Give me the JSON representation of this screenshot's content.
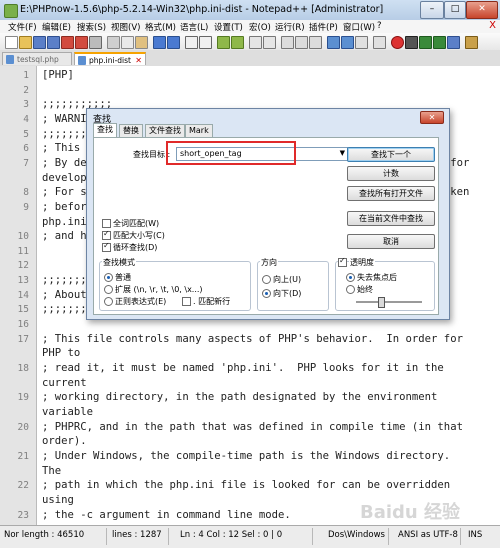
{
  "window": {
    "title": "E:\\PHPnow-1.5.6\\php-5.2.14-Win32\\php.ini-dist - Notepad++ [Administrator]",
    "minimize": "–",
    "maximize": "□",
    "close": "✕"
  },
  "menu": [
    "文件(F)",
    "编辑(E)",
    "搜索(S)",
    "视图(V)",
    "格式(M)",
    "语言(L)",
    "设置(T)",
    "宏(O)",
    "运行(R)",
    "插件(P)",
    "窗口(W)",
    "?"
  ],
  "menu_close": "X",
  "tabs": [
    {
      "label": "testsql.php",
      "active": false
    },
    {
      "label": "php.ini-dist",
      "active": true
    }
  ],
  "editor": {
    "lines": [
      {
        "num": "1",
        "text": "[PHP]"
      },
      {
        "num": "2",
        "text": ""
      },
      {
        "num": "3",
        "text": ";;;;;;;;;;;"
      },
      {
        "num": "4",
        "text": "; WARNING ;"
      },
      {
        "num": "5",
        "text": ";;;;;;;;;;;"
      },
      {
        "num": "6",
        "text": "; This is the default settings file for new PHP installations."
      },
      {
        "num": "7",
        "text": "; By default, PHP installs itself with a configuration suitable for"
      },
      {
        "num": "",
        "text": "development purposes, and *NOT* for production purposes."
      },
      {
        "num": "8",
        "text": "; For several security-oriented considerations that should be taken"
      },
      {
        "num": "9",
        "text": "; before going online with your site, please consult"
      },
      {
        "num": "",
        "text": "php.ini-recommended and http://php.net/manual/en/security.php."
      },
      {
        "num": "10",
        "text": "; and http://php.net/manual/en/security.php."
      },
      {
        "num": "11",
        "text": ""
      },
      {
        "num": "12",
        "text": ""
      },
      {
        "num": "13",
        "text": ";;;;;;;;;;;;;;;;;;;;"
      },
      {
        "num": "14",
        "text": "; About this file ;"
      },
      {
        "num": "15",
        "text": ";;;;;;;;;;;;;;;;;;;;"
      },
      {
        "num": "16",
        "text": ""
      },
      {
        "num": "17",
        "text": "; This file controls many aspects of PHP's behavior.  In order for"
      },
      {
        "num": "",
        "text": "PHP to"
      },
      {
        "num": "18",
        "text": "; read it, it must be named 'php.ini'.  PHP looks for it in the"
      },
      {
        "num": "",
        "text": "current"
      },
      {
        "num": "19",
        "text": "; working directory, in the path designated by the environment"
      },
      {
        "num": "",
        "text": "variable"
      },
      {
        "num": "20",
        "text": "; PHPRC, and in the path that was defined in compile time (in that"
      },
      {
        "num": "",
        "text": "order)."
      },
      {
        "num": "21",
        "text": "; Under Windows, the compile-time path is the Windows directory."
      },
      {
        "num": "",
        "text": "The"
      },
      {
        "num": "22",
        "text": "; path in which the php.ini file is looked for can be overridden"
      },
      {
        "num": "",
        "text": "using"
      },
      {
        "num": "23",
        "text": "; the -c argument in command line mode."
      },
      {
        "num": "24",
        "text": ";"
      }
    ]
  },
  "status": {
    "length": "Nor length : 46510",
    "lines": "lines : 1287",
    "position": "Ln : 4    Col : 12    Sel : 0 | 0",
    "eol": "Dos\\Windows",
    "encoding": "ANSI as UTF-8",
    "mode": "INS"
  },
  "dialog": {
    "title": "查找",
    "close": "✕",
    "tabs": [
      "查找",
      "替换",
      "文件查找",
      "Mark"
    ],
    "find_label": "查找目标 :",
    "find_value": "short_open_tag",
    "buttons": {
      "find_next": "查找下一个",
      "count": "计数",
      "find_all_open": "查找所有打开文件",
      "find_all_current": "在当前文件中查找",
      "cancel": "取消"
    },
    "options": {
      "whole_word": "全词匹配(W)",
      "match_case": "匹配大小写(C)",
      "wrap": "循环查找(D)"
    },
    "search_mode": {
      "title": "查找模式",
      "normal": "普通",
      "extended": "扩展 (\\n, \\r, \\t, \\0, \\x...)",
      "regex": "正则表达式(E)",
      "dot_newline": ". 匹配新行"
    },
    "direction": {
      "title": "方向",
      "up": "向上(U)",
      "down": "向下(D)"
    },
    "transparency": {
      "title": "透明度",
      "on_lose_focus": "失去焦点后",
      "always": "始终"
    }
  },
  "watermark": "Baidu 经验",
  "colors": {
    "accent_tab": "#f6a300",
    "highlight_box": "#e02a2a",
    "dialog_bg": "#dbe6f4"
  }
}
